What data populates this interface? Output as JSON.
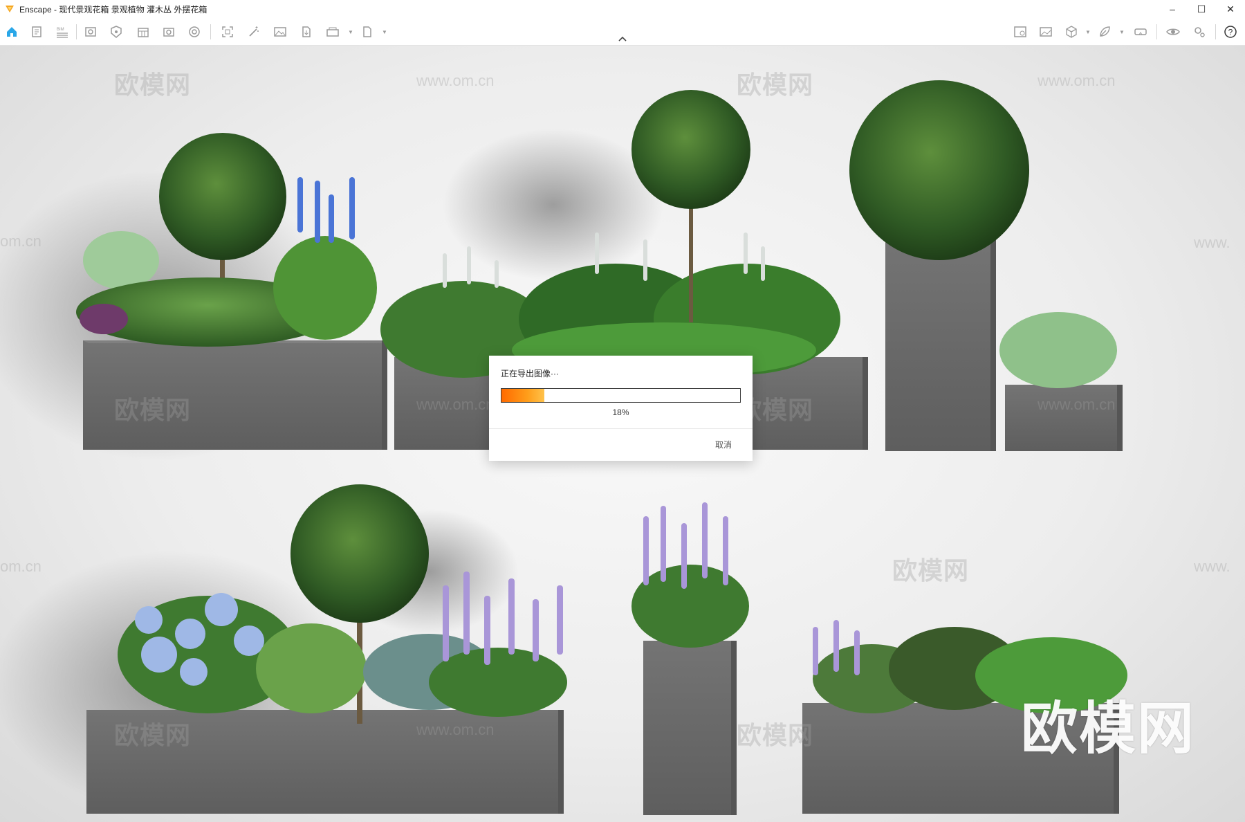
{
  "window": {
    "title": "Enscape - 现代景观花箱 景观植物 灌木丛 外摆花箱",
    "controls": {
      "minimize": "–",
      "maximize": "☐",
      "close": "✕"
    }
  },
  "toolbar": {
    "left_icons": [
      "home-icon",
      "document-icon",
      "bim-icon",
      "view-icon",
      "asset-library-icon",
      "material-icon",
      "screenshot-icon",
      "settings-sphere-icon",
      "capture-icon",
      "magic-icon",
      "image-icon",
      "export-icon",
      "batch-render-icon",
      "export-file-icon"
    ],
    "right_icons": [
      "image-compare-icon",
      "gallery-icon",
      "cube-icon",
      "leaf-icon",
      "vr-icon",
      "eye-icon",
      "settings-icon",
      "help-icon"
    ],
    "bim_label": "BIM",
    "help_label": "?"
  },
  "watermarks": {
    "brand": "欧模网",
    "url": "www.om.cn",
    "url_partial_left": "om.cn",
    "url_partial_right": "www."
  },
  "export_dialog": {
    "title": "正在导出图像···",
    "progress": 0.18,
    "progress_label": "18%",
    "cancel_label": "取消",
    "accent": "#ff7a00"
  },
  "colors": {
    "planter": "#6b6b6b",
    "foliage_dark": "#2f5a24",
    "foliage_light": "#5c8f3a",
    "flower_blue": "#4a74d6",
    "flower_lavender": "#a996d8",
    "hydrangea": "#9fb8e6"
  }
}
